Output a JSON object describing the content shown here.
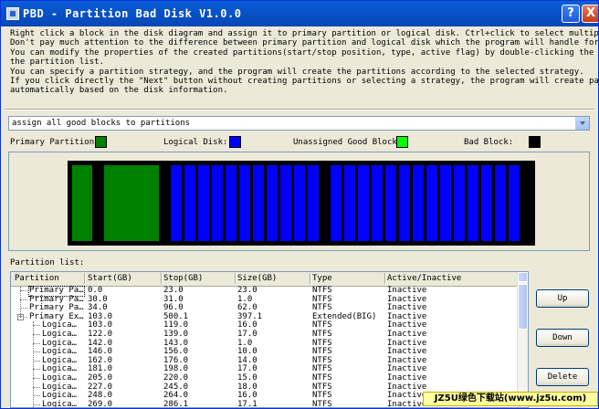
{
  "window": {
    "title": "PBD - Partition Bad Disk V1.0.0",
    "help_label": "?",
    "close_label": "X"
  },
  "instructions": [
    "Right click a block in the disk diagram and assign it to primary partition or logical disk. Ctrl+click to select multiple blocks.",
    "Don't pay much attention to the difference between primary partition and logical disk which the program will handle for you.",
    "You can modify the properties of the created partitions(start/stop position, type, active flag) by double-clicking the item in",
    "the partition list.",
    "You can specify a partition strategy, and the program will create the partitions according to the selected strategy.",
    "If you click directly the \"Next\" button without creating partitions or selecting a strategy, the program will create partitions",
    "automatically based on the disk information."
  ],
  "strategy": {
    "selected": "assign all good blocks to partitions"
  },
  "legend": {
    "primary_label": "Primary Partition:",
    "logical_label": "Logical Disk:",
    "unassigned_label": "Unassigned Good Block:",
    "bad_label": "Bad Block:",
    "primary_color": "#008000",
    "logical_color": "#0000ff",
    "unassigned_color": "#00ff00",
    "bad_color": "#000000"
  },
  "disk_blocks": [
    "primary",
    "bad",
    "primary",
    "bad",
    "logical",
    "logical",
    "logical",
    "logical",
    "logical",
    "logical",
    "logical",
    "logical",
    "logical",
    "logical",
    "logical",
    "bad",
    "logical",
    "logical",
    "logical",
    "logical",
    "logical",
    "logical",
    "logical",
    "logical",
    "logical",
    "logical",
    "logical",
    "logical",
    "logical",
    "logical"
  ],
  "partition_list": {
    "label": "Partition list:",
    "columns": [
      "Partition",
      "Start(GB)",
      "Stop(GB)",
      "Size(GB)",
      "Type",
      "Active/Inactive"
    ],
    "rows": [
      {
        "name": "Primary Pa…",
        "start": "0.0",
        "stop": "23.0",
        "size": "23.0",
        "type": "NTFS",
        "active": "Inactive",
        "level": 1
      },
      {
        "name": "Primary Pa…",
        "start": "30.0",
        "stop": "31.0",
        "size": "1.0",
        "type": "NTFS",
        "active": "Inactive",
        "level": 1
      },
      {
        "name": "Primary Pa…",
        "start": "34.0",
        "stop": "96.0",
        "size": "62.0",
        "type": "NTFS",
        "active": "Inactive",
        "level": 1
      },
      {
        "name": "Primary Ex…",
        "start": "103.0",
        "stop": "500.1",
        "size": "397.1",
        "type": "Extended(BIG)",
        "active": "Inactive",
        "level": 1
      },
      {
        "name": "Logica…",
        "start": "103.0",
        "stop": "119.0",
        "size": "16.0",
        "type": "NTFS",
        "active": "Inactive",
        "level": 2
      },
      {
        "name": "Logica…",
        "start": "122.0",
        "stop": "139.0",
        "size": "17.0",
        "type": "NTFS",
        "active": "Inactive",
        "level": 2
      },
      {
        "name": "Logica…",
        "start": "142.0",
        "stop": "143.0",
        "size": "1.0",
        "type": "NTFS",
        "active": "Inactive",
        "level": 2
      },
      {
        "name": "Logica…",
        "start": "146.0",
        "stop": "156.0",
        "size": "10.0",
        "type": "NTFS",
        "active": "Inactive",
        "level": 2
      },
      {
        "name": "Logica…",
        "start": "162.0",
        "stop": "176.0",
        "size": "14.0",
        "type": "NTFS",
        "active": "Inactive",
        "level": 2
      },
      {
        "name": "Logica…",
        "start": "181.0",
        "stop": "198.0",
        "size": "17.0",
        "type": "NTFS",
        "active": "Inactive",
        "level": 2
      },
      {
        "name": "Logica…",
        "start": "205.0",
        "stop": "220.0",
        "size": "15.0",
        "type": "NTFS",
        "active": "Inactive",
        "level": 2
      },
      {
        "name": "Logica…",
        "start": "227.0",
        "stop": "245.0",
        "size": "18.0",
        "type": "NTFS",
        "active": "Inactive",
        "level": 2
      },
      {
        "name": "Logica…",
        "start": "248.0",
        "stop": "264.0",
        "size": "16.0",
        "type": "NTFS",
        "active": "Inactive",
        "level": 2
      },
      {
        "name": "Logica…",
        "start": "269.0",
        "stop": "286.1",
        "size": "17.1",
        "type": "NTFS",
        "active": "Inactive",
        "level": 2
      }
    ]
  },
  "buttons": {
    "up": "Up",
    "down": "Down",
    "delete": "Delete"
  },
  "watermark": "JZ5U绿色下载站(www.jz5u.com)"
}
